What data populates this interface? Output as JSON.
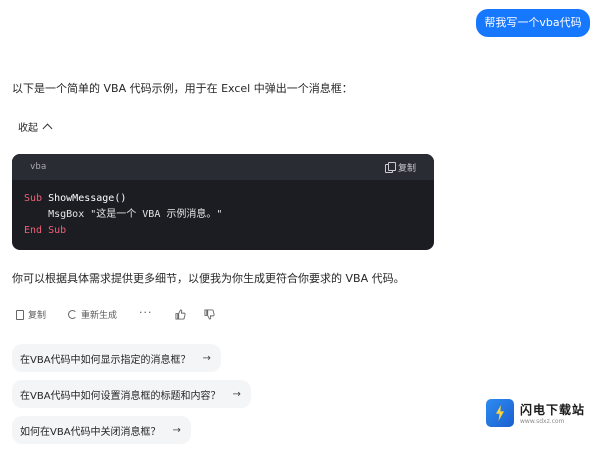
{
  "user_message": "帮我写一个vba代码",
  "intro_text": "以下是一个简单的 VBA 代码示例，用于在 Excel 中弹出一个消息框：",
  "collapse_label": "收起",
  "code": {
    "language": "vba",
    "copy_label": "复制",
    "line1_kw": "Sub",
    "line1_name": "ShowMessage()",
    "line2_indent": "    ",
    "line2_call": "MsgBox",
    "line2_str": "\"这是一个 VBA 示例消息。\"",
    "line3_kw": "End Sub"
  },
  "followup_text": "你可以根据具体需求提供更多细节，以便我为你生成更符合你要求的 VBA 代码。",
  "actions": {
    "copy_label": "复制",
    "regenerate_label": "重新生成",
    "more_label": "···"
  },
  "suggestions": [
    "在VBA代码中如何显示指定的消息框？",
    "在VBA代码中如何设置消息框的标题和内容？",
    "如何在VBA代码中关闭消息框？"
  ],
  "watermark": {
    "title": "闪电下载站",
    "url": "www.sdxz.com"
  }
}
